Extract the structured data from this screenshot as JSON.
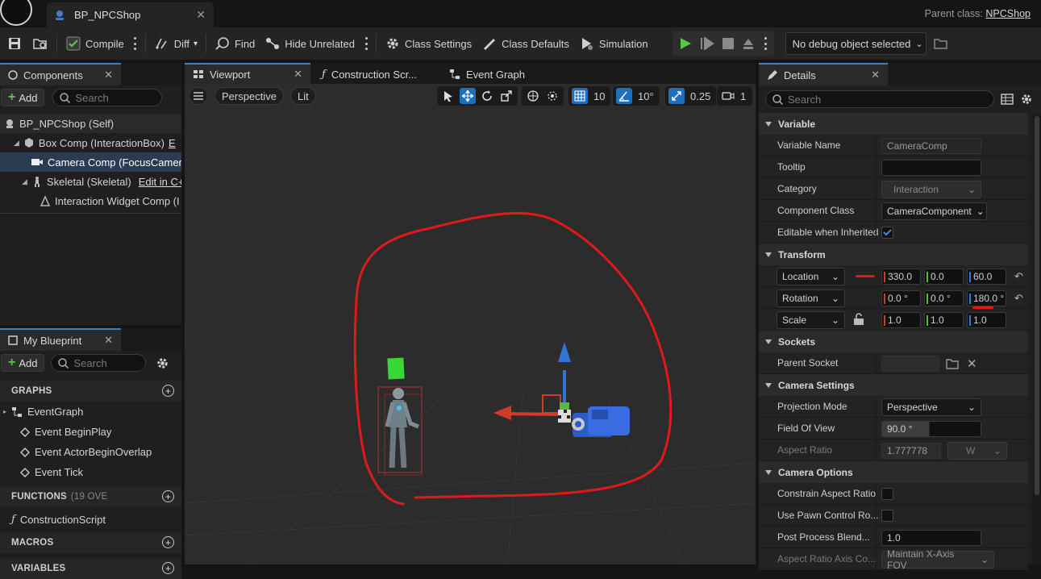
{
  "titlebar": {
    "doc_tab": "BP_NPCShop",
    "parent_label": "Parent class:",
    "parent_value": "NPCShop"
  },
  "toolbar": {
    "compile": "Compile",
    "diff": "Diff",
    "find": "Find",
    "hide_unrelated": "Hide Unrelated",
    "class_settings": "Class Settings",
    "class_defaults": "Class Defaults",
    "simulation": "Simulation",
    "debug_select": "No debug object selected"
  },
  "components": {
    "tab": "Components",
    "add": "Add",
    "search_placeholder": "Search",
    "items": [
      {
        "label": "BP_NPCShop (Self)"
      },
      {
        "label": "Box Comp (InteractionBox)",
        "link": "E"
      },
      {
        "label": "Camera Comp (FocusCamera)"
      },
      {
        "label": "Skeletal (Skeletal)",
        "link": "Edit in C++"
      },
      {
        "label": "Interaction Widget Comp (I"
      }
    ]
  },
  "my_blueprint": {
    "tab": "My Blueprint",
    "add": "Add",
    "search_placeholder": "Search",
    "sections": {
      "graphs": "GRAPHS",
      "functions": "FUNCTIONS",
      "functions_count": "(19 OVE",
      "macros": "MACROS",
      "variables": "VARIABLES"
    },
    "graph": "EventGraph",
    "events": [
      "Event BeginPlay",
      "Event ActorBeginOverlap",
      "Event Tick"
    ],
    "function": "ConstructionScript"
  },
  "viewport": {
    "tabs": [
      "Viewport",
      "Construction Scr...",
      "Event Graph"
    ],
    "perspective": "Perspective",
    "lit": "Lit",
    "grid_snap": "10",
    "rotation_snap": "10°",
    "scale_snap": "0.25",
    "camera_speed": "1"
  },
  "details": {
    "tab": "Details",
    "search_placeholder": "Search",
    "variable": {
      "title": "Variable",
      "variable_name_label": "Variable Name",
      "variable_name": "CameraComp",
      "tooltip_label": "Tooltip",
      "tooltip": "",
      "category_label": "Category",
      "category": "Interaction",
      "component_class_label": "Component Class",
      "component_class": "CameraComponent",
      "editable_label": "Editable when Inherited",
      "editable_checked": true
    },
    "transform": {
      "title": "Transform",
      "location_label": "Location",
      "location": [
        "330.0",
        "0.0",
        "60.0"
      ],
      "rotation_label": "Rotation",
      "rotation": [
        "0.0 °",
        "0.0 °",
        "180.0 °"
      ],
      "scale_label": "Scale",
      "scale": [
        "1.0",
        "1.0",
        "1.0"
      ]
    },
    "sockets": {
      "title": "Sockets",
      "parent_socket_label": "Parent Socket"
    },
    "camera_settings": {
      "title": "Camera Settings",
      "projection_label": "Projection Mode",
      "projection": "Perspective",
      "fov_label": "Field Of View",
      "fov": "90.0 °",
      "aspect_label": "Aspect Ratio",
      "aspect": "1.777778",
      "aspect_unit": "W"
    },
    "camera_options": {
      "title": "Camera Options",
      "constrain_label": "Constrain Aspect Ratio",
      "use_pawn_label": "Use Pawn Control Ro...",
      "post_process_label": "Post Process Blend...",
      "post_process": "1.0",
      "aspect_axis_label": "Aspect Ratio Axis Co...",
      "aspect_axis": "Maintain X-Axis FOV"
    }
  },
  "colors": {
    "accent": "#3a82c4",
    "annotation": "#e01a1a",
    "play": "#5ec34b"
  }
}
